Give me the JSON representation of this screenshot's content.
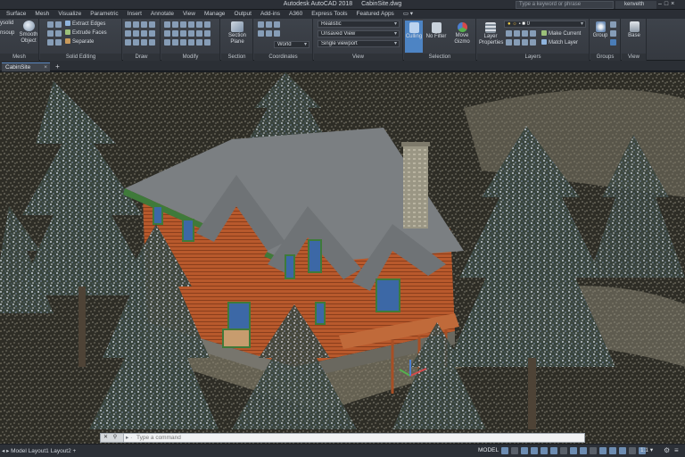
{
  "titlebar": {
    "app_name": "Autodesk AutoCAD 2018",
    "file_name": "CabinSite.dwg",
    "search_placeholder": "Type a keyword or phrase",
    "user": "kenvelth",
    "window_controls": "–□×"
  },
  "ribbon_tabs": [
    "Surface",
    "Mesh",
    "Visualize",
    "Parametric",
    "Insert",
    "Annotate",
    "View",
    "Manage",
    "Output",
    "Add-ins",
    "A360",
    "Express Tools",
    "Featured Apps"
  ],
  "ribbon_tabs_more": "▭ ▾",
  "ribbon": {
    "mesh": {
      "label": "Mesh",
      "smooth_object": "Smooth Object",
      "left_label_1": "ysolid",
      "left_label_2": "nsoup"
    },
    "solid_editing": {
      "label": "Solid Editing",
      "extract_edges": "Extract Edges",
      "extrude_faces": "Extrude Faces",
      "separate": "Separate"
    },
    "draw": {
      "label": "Draw"
    },
    "modify": {
      "label": "Modify"
    },
    "section": {
      "label": "Section",
      "section_plane": "Section Plane"
    },
    "coordinates": {
      "label": "Coordinates",
      "ucs": "World"
    },
    "view": {
      "label": "View",
      "visual_style": "Realistic",
      "named_view": "Unsaved View",
      "viewport": "Single viewport"
    },
    "selection": {
      "label": "Selection",
      "culling": "Culling",
      "no_filter": "No Filter",
      "move_gizmo": "Move Gizmo"
    },
    "layers": {
      "label": "Layers",
      "layer_properties": "Layer Properties",
      "layer_value": "0",
      "make_current": "Make Current",
      "match_layer": "Match Layer"
    },
    "groups": {
      "label": "Groups",
      "group": "Group"
    },
    "view2": {
      "label": "View",
      "base": "Base"
    }
  },
  "doc_tab": {
    "name": "CabinSite",
    "close": "×",
    "new_tab": "+"
  },
  "command_line": {
    "buttons": "✕ ⚲",
    "prompt": "▸ ·",
    "placeholder": "Type a command"
  },
  "statusbar": {
    "layout_tabs": "◂ ▸ Model  Layout1  Layout2  +",
    "model": "MODEL",
    "scale": "1:1 ▾",
    "gear": "⚙",
    "menu": "≡"
  },
  "colors": {
    "accent": "#4d84c4",
    "ribbon": "#3e434b",
    "log_wall": "#b5562a",
    "roof": "#7b7f82",
    "trim": "#3f7a3a",
    "window": "#3c68a6"
  }
}
